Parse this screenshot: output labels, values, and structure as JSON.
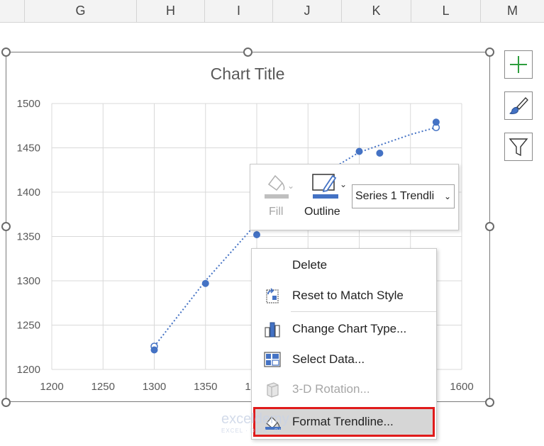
{
  "columns": [
    "G",
    "H",
    "I",
    "J",
    "K",
    "L",
    "M"
  ],
  "chart": {
    "title": "Chart Title"
  },
  "chart_data": {
    "type": "scatter",
    "title": "Chart Title",
    "x": [
      1300,
      1350,
      1400,
      1500,
      1520,
      1575
    ],
    "y": [
      1222,
      1297,
      1352,
      1446,
      1444,
      1479
    ],
    "trendline": {
      "style": "dotted",
      "x": [
        1300,
        1350,
        1400,
        1450,
        1500,
        1550,
        1575
      ],
      "y": [
        1226,
        1300,
        1365,
        1410,
        1445,
        1465,
        1473
      ]
    },
    "xlim": [
      1200,
      1600
    ],
    "ylim": [
      1200,
      1500
    ],
    "x_ticks": [
      "1200",
      "1250",
      "1300",
      "1350",
      "1400",
      "1450",
      "1500",
      "1550",
      "1600"
    ],
    "y_ticks": [
      "1200",
      "1250",
      "1300",
      "1350",
      "1400",
      "1450",
      "1500"
    ],
    "grid": true,
    "color": "#4472c4"
  },
  "mini_toolbar": {
    "fill_label": "Fill",
    "outline_label": "Outline",
    "series_select": "Series 1 Trendli"
  },
  "context_menu": {
    "items": [
      {
        "label": "Delete",
        "enabled": true
      },
      {
        "label": "Reset to Match Style",
        "enabled": true
      },
      {
        "label": "Change Chart Type...",
        "enabled": true
      },
      {
        "label": "Select Data...",
        "enabled": true
      },
      {
        "label": "3-D Rotation...",
        "enabled": false
      },
      {
        "label": "Format Trendline...",
        "enabled": true,
        "highlighted": true
      }
    ]
  },
  "watermark": {
    "brand": "exceldemy",
    "tagline": "EXCEL · DATA · BI"
  },
  "colors": {
    "accent": "#4472c4",
    "highlight_border": "#e01b1b",
    "add_icon": "#2e9e3e"
  }
}
